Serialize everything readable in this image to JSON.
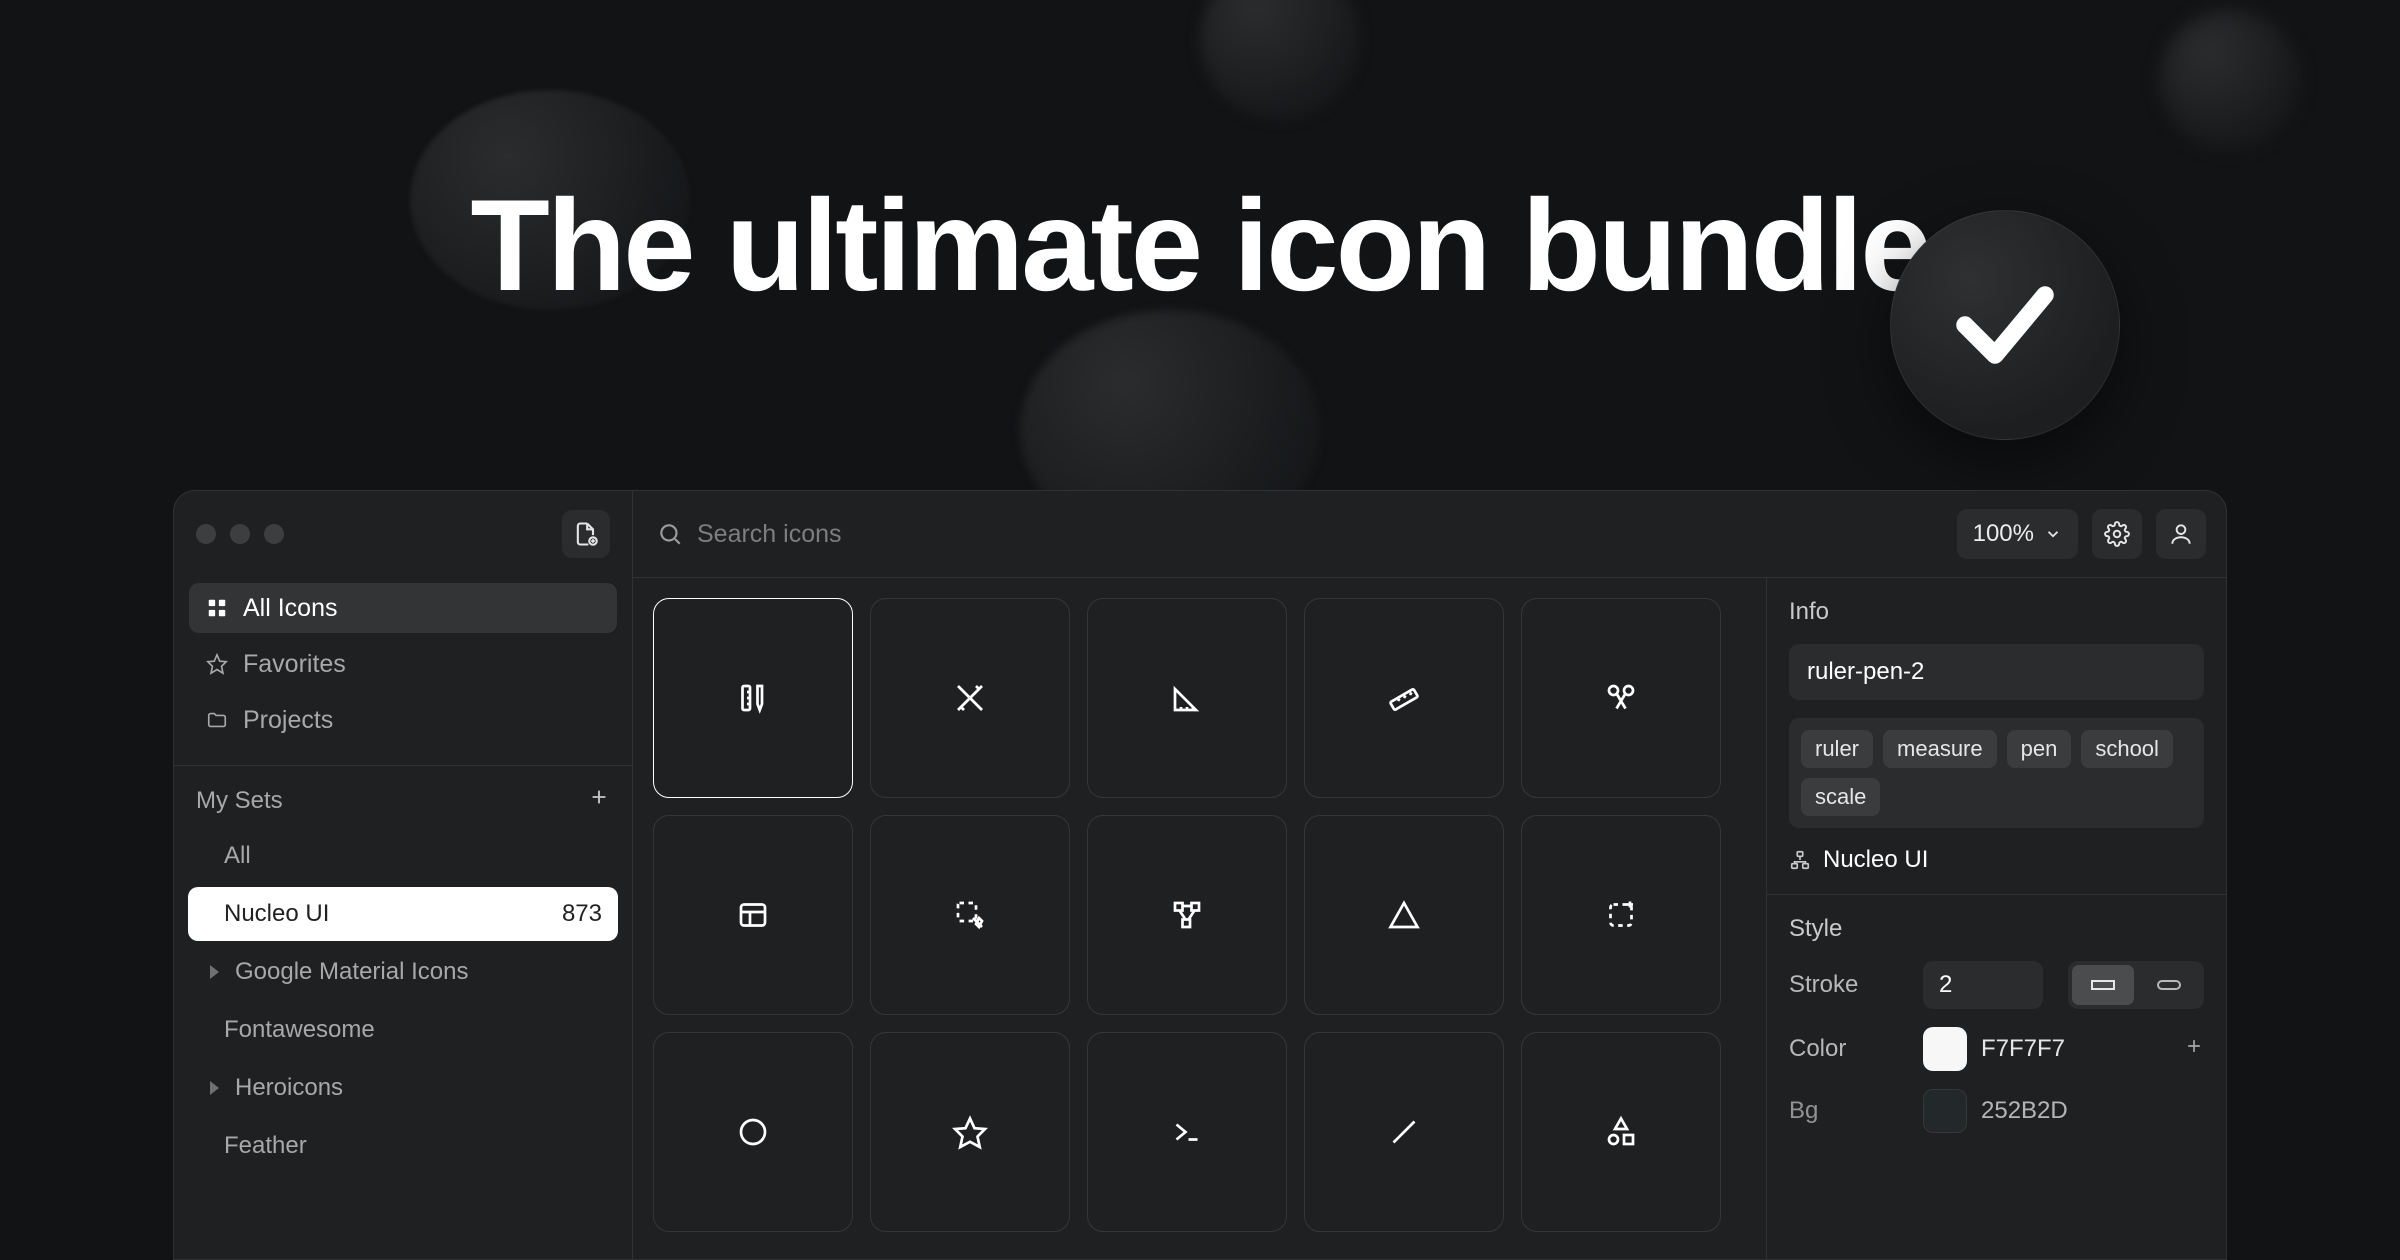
{
  "hero": {
    "title": "The ultimate icon bundle"
  },
  "toolbar": {
    "search_placeholder": "Search icons",
    "zoom": "100%"
  },
  "sidebar": {
    "nav": {
      "all_icons": "All Icons",
      "favorites": "Favorites",
      "projects": "Projects"
    },
    "my_sets": {
      "title": "My Sets",
      "items": [
        {
          "label": "All",
          "expandable": false
        },
        {
          "label": "Nucleo UI",
          "count": "873",
          "active": true,
          "expandable": false
        },
        {
          "label": "Google Material Icons",
          "expandable": true
        },
        {
          "label": "Fontawesome",
          "expandable": false
        },
        {
          "label": "Heroicons",
          "expandable": true
        },
        {
          "label": "Feather",
          "expandable": false
        }
      ]
    }
  },
  "grid": {
    "icons": [
      "ruler-pen",
      "pencil-ruler-cross",
      "ruler-triangle",
      "ruler-diagonal",
      "scissors",
      "layout",
      "select",
      "vector-nodes",
      "triangle-warning",
      "dashed-square-plus",
      "circle",
      "star",
      "terminal",
      "line",
      "shapes"
    ],
    "selected_index": 0
  },
  "inspector": {
    "info_title": "Info",
    "icon_name": "ruler-pen-2",
    "tags": [
      "ruler",
      "measure",
      "pen",
      "school",
      "scale"
    ],
    "set_link": "Nucleo UI",
    "style_title": "Style",
    "stroke_label": "Stroke",
    "stroke_value": "2",
    "color_label": "Color",
    "color_hex": "F7F7F7",
    "bg_label": "Bg",
    "bg_hex": "252B2D"
  }
}
